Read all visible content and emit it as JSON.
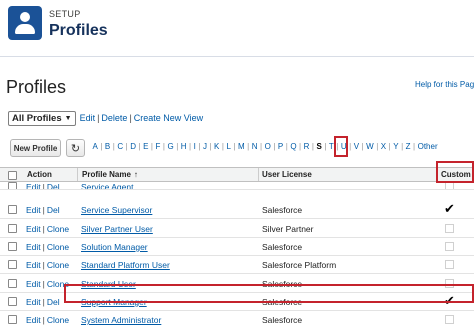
{
  "header": {
    "section": "SETUP",
    "title": "Profiles"
  },
  "page": {
    "title": "Profiles",
    "help_link": "Help for this Page"
  },
  "view": {
    "selected": "All Profiles",
    "edit": "Edit",
    "delete": "Delete",
    "create": "Create New View"
  },
  "toolbar": {
    "new_profile": "New Profile",
    "refresh_icon": "refresh-icon"
  },
  "alphabet": {
    "letters": [
      "A",
      "B",
      "C",
      "D",
      "E",
      "F",
      "G",
      "H",
      "I",
      "J",
      "K",
      "L",
      "M",
      "N",
      "O",
      "P",
      "Q",
      "R",
      "S",
      "T",
      "U",
      "V",
      "W",
      "X",
      "Y",
      "Z",
      "Other"
    ],
    "selected": "S"
  },
  "table": {
    "columns": {
      "action": "Action",
      "profile_name": "Profile Name",
      "sort_indicator": "↑",
      "user_license": "User License",
      "custom": "Custom"
    },
    "rows": [
      {
        "action1": "Edit",
        "action2": "Del",
        "name": "Service Agent",
        "license": "",
        "custom": false
      },
      {
        "action1": "Edit",
        "action2": "Del",
        "name": "Service Supervisor",
        "license": "Salesforce",
        "custom": true
      },
      {
        "action1": "Edit",
        "action2": "Clone",
        "name": "Silver Partner User",
        "license": "Silver Partner",
        "custom": false
      },
      {
        "action1": "Edit",
        "action2": "Clone",
        "name": "Solution Manager",
        "license": "Salesforce",
        "custom": false
      },
      {
        "action1": "Edit",
        "action2": "Clone",
        "name": "Standard Platform User",
        "license": "Salesforce Platform",
        "custom": false
      },
      {
        "action1": "Edit",
        "action2": "Clone",
        "name": "Standard User",
        "license": "Salesforce",
        "custom": false
      },
      {
        "action1": "Edit",
        "action2": "Del",
        "name": "Support Manager",
        "license": "Salesforce",
        "custom": true
      },
      {
        "action1": "Edit",
        "action2": "Clone",
        "name": "System Administrator",
        "license": "Salesforce",
        "custom": false
      }
    ]
  },
  "colors": {
    "link": "#015ba7",
    "highlight": "#c4232c",
    "header_icon": "#1b5297"
  }
}
